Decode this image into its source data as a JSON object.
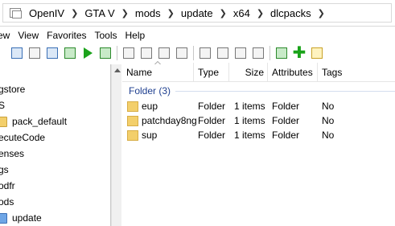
{
  "address_bar": {
    "crumbs": [
      "OpenIV",
      "GTA V",
      "mods",
      "update",
      "x64",
      "dlcpacks"
    ]
  },
  "menu": [
    "ew",
    "View",
    "Favorites",
    "Tools",
    "Help"
  ],
  "tree": {
    "items": [
      {
        "label": "gstore",
        "icon": "none"
      },
      {
        "label": "S",
        "icon": "none"
      },
      {
        "label": "pack_default",
        "icon": "folder-icon"
      },
      {
        "label": "ecuteCode",
        "icon": "none"
      },
      {
        "label": "enses",
        "icon": "none"
      },
      {
        "label": "gs",
        "icon": "none"
      },
      {
        "label": "odfr",
        "icon": "none"
      },
      {
        "label": "ods",
        "icon": "none"
      },
      {
        "label": "update",
        "icon": "folder-blue-icon"
      }
    ]
  },
  "list": {
    "columns": {
      "name": "Name",
      "type": "Type",
      "size": "Size",
      "attributes": "Attributes",
      "tags": "Tags"
    },
    "group_label": "Folder (3)",
    "rows": [
      {
        "name": "eup",
        "type": "Folder",
        "size": "1 items",
        "attributes": "Folder",
        "tags": "No"
      },
      {
        "name": "patchday8ng",
        "type": "Folder",
        "size": "1 items",
        "attributes": "Folder",
        "tags": "No"
      },
      {
        "name": "sup",
        "type": "Folder",
        "size": "1 items",
        "attributes": "Folder",
        "tags": "No"
      }
    ]
  },
  "colors": {
    "group_text": "#1e3f8f",
    "folder_yellow": "#f3cf6b",
    "folder_blue": "#6fa6e6"
  }
}
